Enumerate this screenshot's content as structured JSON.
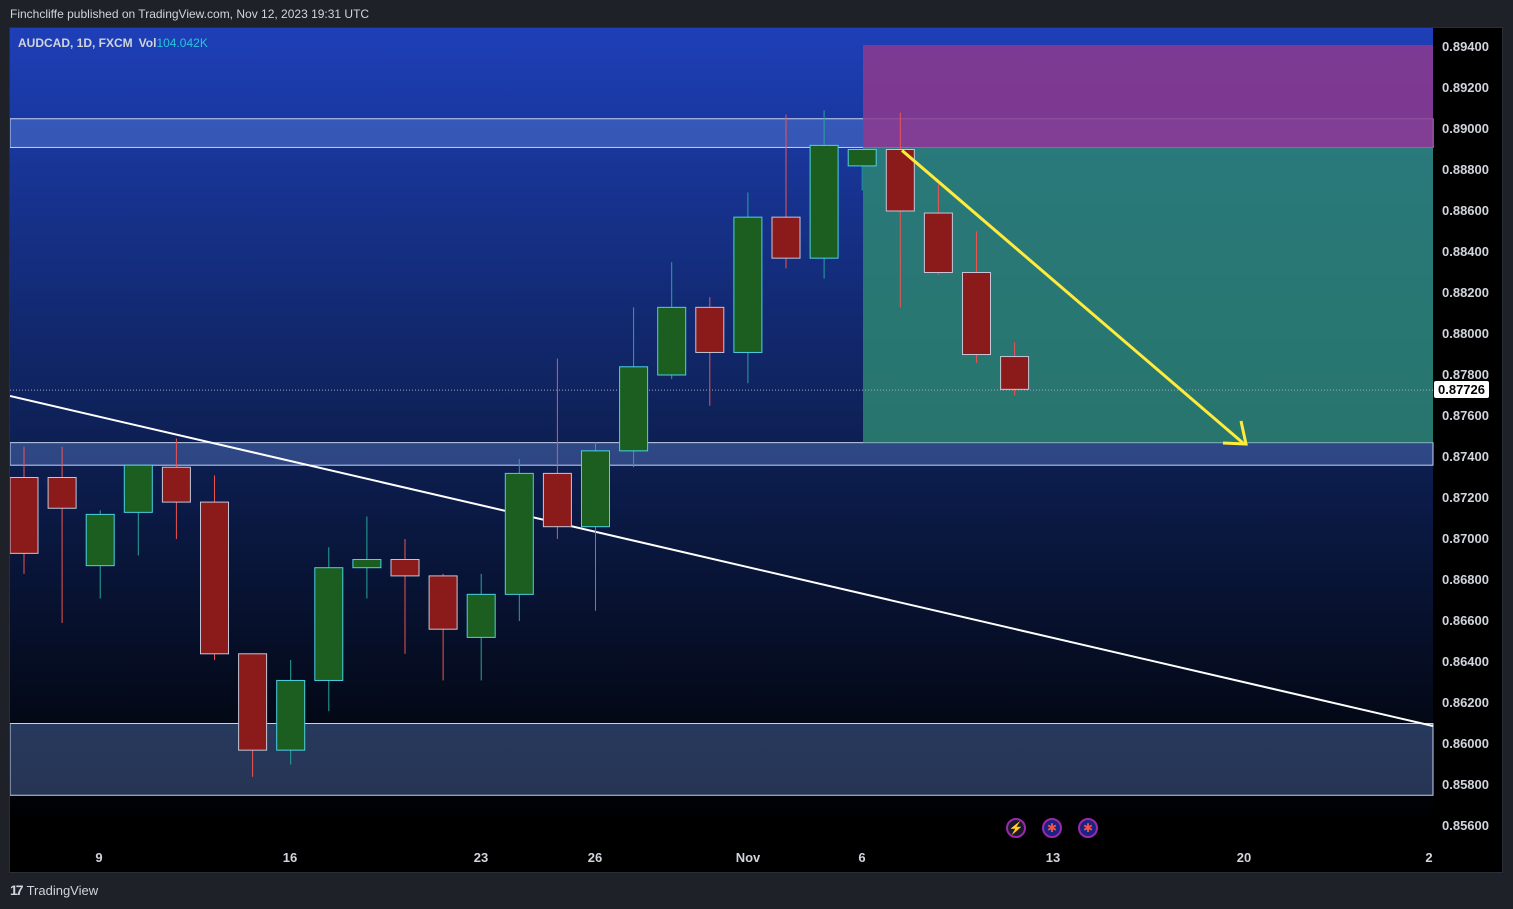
{
  "header": {
    "publisher_text": "Finchcliffe published on TradingView.com, Nov 12, 2023 19:31 UTC"
  },
  "footer": {
    "brand": "TradingView",
    "logo_glyph": "17"
  },
  "legend": {
    "symbol": "AUDCAD, 1D, FXCM",
    "vol_label": "Vol",
    "vol_value": "104.042K"
  },
  "current_price": "0.87726",
  "colors": {
    "up_candle": "#1b5e20",
    "down_candle": "#8b1a1a",
    "wick_up": "#26a69a",
    "wick_down": "#ef5350",
    "trendline": "#ffffff",
    "arrow": "#ffeb3b",
    "target_zone": "#2e8b73",
    "stop_zone": "#8e3a8e"
  },
  "icons": [
    "bolt-icon",
    "flag-icon",
    "flag-icon"
  ],
  "chart_data": {
    "type": "candlestick",
    "symbol": "AUDCAD",
    "timeframe": "1D",
    "y_axis": {
      "ticks": [
        "0.89400",
        "0.89200",
        "0.89000",
        "0.88800",
        "0.88600",
        "0.88400",
        "0.88200",
        "0.88000",
        "0.87800",
        "0.87600",
        "0.87400",
        "0.87200",
        "0.87000",
        "0.86800",
        "0.86600",
        "0.86400",
        "0.86200",
        "0.86000",
        "0.85800",
        "0.85600"
      ],
      "range": [
        0.8558,
        0.895
      ]
    },
    "x_axis": {
      "ticks": [
        "9",
        "16",
        "23",
        "26",
        "Nov",
        "6",
        "13",
        "20",
        "2"
      ]
    },
    "candles": [
      {
        "o": 0.873,
        "h": 0.8745,
        "l": 0.8683,
        "c": 0.8693
      },
      {
        "o": 0.873,
        "h": 0.8745,
        "l": 0.8659,
        "c": 0.8715
      },
      {
        "o": 0.8687,
        "h": 0.8714,
        "l": 0.8671,
        "c": 0.8712
      },
      {
        "o": 0.8713,
        "h": 0.8736,
        "l": 0.8692,
        "c": 0.8736
      },
      {
        "o": 0.8735,
        "h": 0.8749,
        "l": 0.87,
        "c": 0.8718
      },
      {
        "o": 0.8718,
        "h": 0.8731,
        "l": 0.8641,
        "c": 0.8644
      },
      {
        "o": 0.8644,
        "h": 0.8625,
        "l": 0.8584,
        "c": 0.8597
      },
      {
        "o": 0.8597,
        "h": 0.8641,
        "l": 0.859,
        "c": 0.8631
      },
      {
        "o": 0.8631,
        "h": 0.8696,
        "l": 0.8616,
        "c": 0.8686
      },
      {
        "o": 0.8686,
        "h": 0.8711,
        "l": 0.8671,
        "c": 0.869
      },
      {
        "o": 0.869,
        "h": 0.87,
        "l": 0.8644,
        "c": 0.8682
      },
      {
        "o": 0.8682,
        "h": 0.8683,
        "l": 0.8631,
        "c": 0.8656
      },
      {
        "o": 0.8652,
        "h": 0.8683,
        "l": 0.8631,
        "c": 0.8673
      },
      {
        "o": 0.8673,
        "h": 0.8739,
        "l": 0.866,
        "c": 0.8732
      },
      {
        "o": 0.8732,
        "h": 0.8788,
        "l": 0.87,
        "c": 0.8706
      },
      {
        "o": 0.8706,
        "h": 0.8747,
        "l": 0.8665,
        "c": 0.8743
      },
      {
        "o": 0.8743,
        "h": 0.8813,
        "l": 0.8735,
        "c": 0.8784
      },
      {
        "o": 0.878,
        "h": 0.8835,
        "l": 0.8778,
        "c": 0.8813
      },
      {
        "o": 0.8813,
        "h": 0.8818,
        "l": 0.8765,
        "c": 0.8791
      },
      {
        "o": 0.8791,
        "h": 0.8869,
        "l": 0.8776,
        "c": 0.8857
      },
      {
        "o": 0.8857,
        "h": 0.8907,
        "l": 0.8832,
        "c": 0.8837
      },
      {
        "o": 0.8837,
        "h": 0.8909,
        "l": 0.8827,
        "c": 0.8892
      },
      {
        "o": 0.8882,
        "h": 0.889,
        "l": 0.887,
        "c": 0.889
      },
      {
        "o": 0.889,
        "h": 0.8908,
        "l": 0.8813,
        "c": 0.886
      },
      {
        "o": 0.8859,
        "h": 0.8873,
        "l": 0.8829,
        "c": 0.883
      },
      {
        "o": 0.883,
        "h": 0.885,
        "l": 0.8786,
        "c": 0.879
      },
      {
        "o": 0.8789,
        "h": 0.8796,
        "l": 0.877,
        "c": 0.8773
      }
    ],
    "zones": [
      {
        "from": 0.8891,
        "to": 0.8905
      },
      {
        "from": 0.8736,
        "to": 0.8747
      },
      {
        "from": 0.8575,
        "to": 0.861
      }
    ],
    "position_tool": {
      "entry": 0.8891,
      "stop": 0.8941,
      "target": 0.8747
    }
  }
}
